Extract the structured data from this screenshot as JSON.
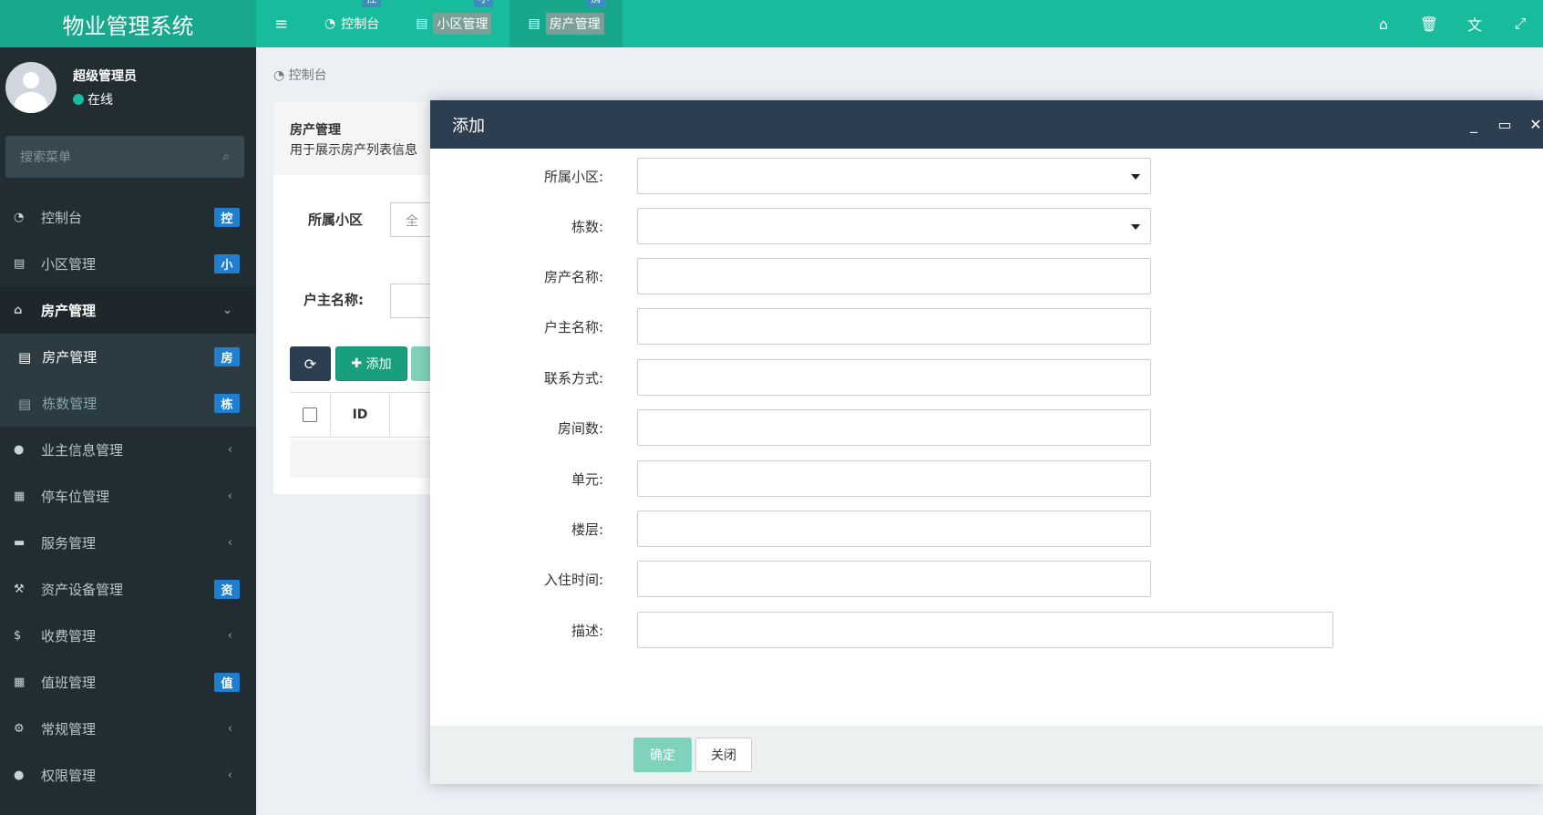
{
  "app": {
    "title": "物业管理系统"
  },
  "topbar": {
    "tabs": [
      {
        "label": "控制台",
        "badge": "控"
      },
      {
        "label": "小区管理",
        "badge": "小"
      },
      {
        "label": "房产管理",
        "badge": "房"
      }
    ],
    "icons": [
      "home-icon",
      "trash-icon",
      "translate-icon",
      "fullscreen-icon"
    ]
  },
  "user": {
    "name": "超级管理员",
    "status": "在线"
  },
  "search": {
    "placeholder": "搜索菜单"
  },
  "sidebar": {
    "items": [
      {
        "label": "控制台",
        "badge": "控",
        "icon": "dashboard-icon"
      },
      {
        "label": "小区管理",
        "badge": "小",
        "icon": "list-icon"
      },
      {
        "label": "房产管理",
        "icon": "home-icon",
        "open": true
      },
      {
        "label": "业主信息管理",
        "icon": "user-icon"
      },
      {
        "label": "停车位管理",
        "icon": "film-icon"
      },
      {
        "label": "服务管理",
        "icon": "keyboard-icon"
      },
      {
        "label": "资产设备管理",
        "badge": "资",
        "icon": "gavel-icon"
      },
      {
        "label": "收费管理",
        "icon": "dollar-icon"
      },
      {
        "label": "值班管理",
        "badge": "值",
        "icon": "calendar-icon"
      },
      {
        "label": "常规管理",
        "icon": "cogs-icon"
      },
      {
        "label": "权限管理",
        "icon": "group-icon"
      }
    ],
    "subitems": [
      {
        "label": "房产管理",
        "badge": "房",
        "active": true
      },
      {
        "label": "栋数管理",
        "badge": "栋",
        "active": false
      }
    ]
  },
  "breadcrumb": {
    "label": "控制台"
  },
  "panel": {
    "title": "房产管理",
    "description": "用于展示房产列表信息",
    "filters": {
      "community_label": "所属小区",
      "community_value": "全",
      "owner_label": "户主名称:"
    },
    "buttons": {
      "add": "添加"
    },
    "table": {
      "id_header": "ID"
    }
  },
  "modal": {
    "title": "添加",
    "fields": [
      {
        "label": "所属小区:",
        "type": "select",
        "value": ""
      },
      {
        "label": "栋数:",
        "type": "select",
        "value": ""
      },
      {
        "label": "房产名称:",
        "type": "text",
        "value": ""
      },
      {
        "label": "户主名称:",
        "type": "text",
        "value": ""
      },
      {
        "label": "联系方式:",
        "type": "text",
        "value": ""
      },
      {
        "label": "房间数:",
        "type": "text",
        "value": ""
      },
      {
        "label": "单元:",
        "type": "text",
        "value": ""
      },
      {
        "label": "楼层:",
        "type": "text",
        "value": ""
      },
      {
        "label": "入住时间:",
        "type": "text",
        "value": ""
      },
      {
        "label": "描述:",
        "type": "textarea",
        "value": ""
      }
    ],
    "ok_label": "确定",
    "close_label": "关闭"
  }
}
